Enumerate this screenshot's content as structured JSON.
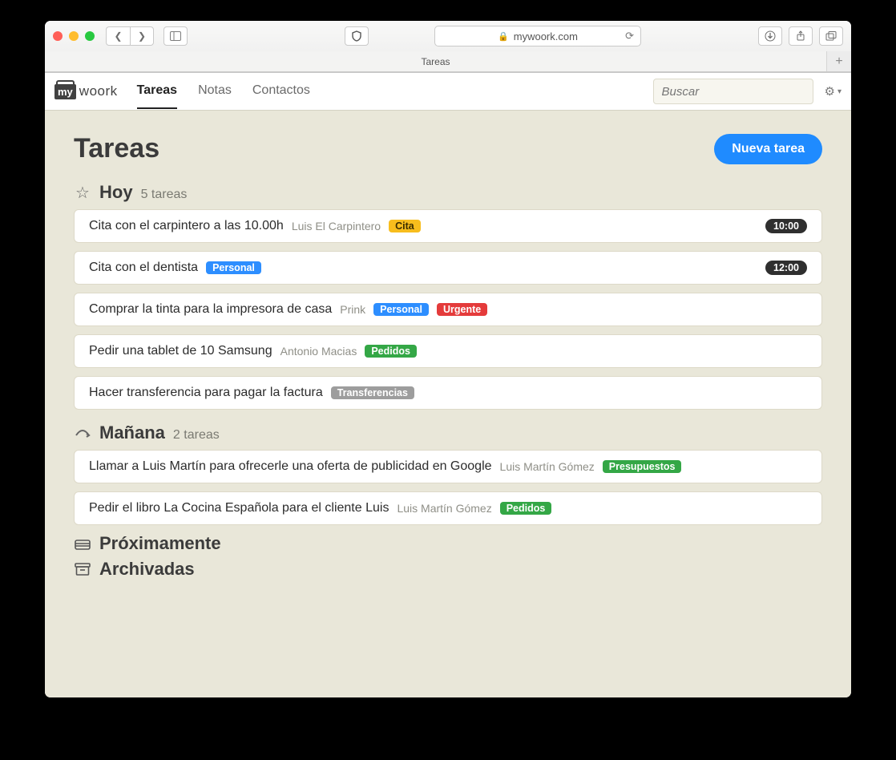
{
  "browser": {
    "url_host": "mywoork.com",
    "tab_title": "Tareas"
  },
  "app": {
    "logo_prefix": "my",
    "logo_suffix": "woork",
    "nav": {
      "tareas": "Tareas",
      "notas": "Notas",
      "contactos": "Contactos"
    },
    "search_placeholder": "Buscar"
  },
  "page": {
    "title": "Tareas",
    "new_task_button": "Nueva tarea"
  },
  "sections": {
    "today": {
      "title": "Hoy",
      "count_text": "5 tareas"
    },
    "tomorrow": {
      "title": "Mañana",
      "count_text": "2 tareas"
    },
    "upcoming": {
      "title": "Próximamente"
    },
    "archived": {
      "title": "Archivadas"
    }
  },
  "today_tasks": [
    {
      "title": "Cita con el carpintero a las 10.00h",
      "contact": "Luis El Carpintero",
      "tags": [
        {
          "label": "Cita",
          "cls": "tag-cita"
        }
      ],
      "time": "10:00"
    },
    {
      "title": "Cita con el dentista",
      "contact": "",
      "tags": [
        {
          "label": "Personal",
          "cls": "tag-personal"
        }
      ],
      "time": "12:00"
    },
    {
      "title": "Comprar la tinta para la impresora de casa",
      "contact": "Prink",
      "tags": [
        {
          "label": "Personal",
          "cls": "tag-personal"
        },
        {
          "label": "Urgente",
          "cls": "tag-urgente"
        }
      ],
      "time": ""
    },
    {
      "title": "Pedir una tablet de 10 Samsung",
      "contact": "Antonio Macias",
      "tags": [
        {
          "label": "Pedidos",
          "cls": "tag-pedidos"
        }
      ],
      "time": ""
    },
    {
      "title": "Hacer transferencia para pagar la factura",
      "contact": "",
      "tags": [
        {
          "label": "Transferencias",
          "cls": "tag-transferencias"
        }
      ],
      "time": ""
    }
  ],
  "tomorrow_tasks": [
    {
      "title": "Llamar a Luis Martín para ofrecerle una oferta de publicidad en Google",
      "contact": "Luis Martín Gómez",
      "tags": [
        {
          "label": "Presupuestos",
          "cls": "tag-presupuestos"
        }
      ],
      "time": ""
    },
    {
      "title": "Pedir el libro La Cocina Española para el cliente Luis",
      "contact": "Luis Martín Gómez",
      "tags": [
        {
          "label": "Pedidos",
          "cls": "tag-pedidos"
        }
      ],
      "time": ""
    }
  ]
}
